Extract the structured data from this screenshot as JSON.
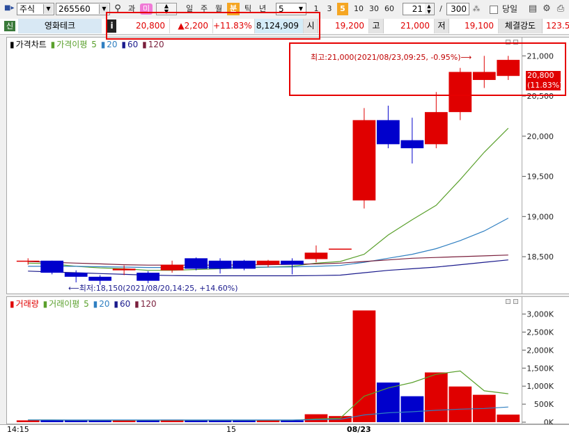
{
  "toolbar": {
    "market": "주식",
    "code": "265560",
    "search_glyph": "⚲",
    "btn_gwa": "과",
    "btn_mi": "미",
    "period_buttons": [
      "일",
      "주",
      "월",
      "분",
      "틱",
      "년"
    ],
    "selected_period": "분",
    "interval_value": "5",
    "interval_buttons": [
      "1",
      "3",
      "5",
      "10",
      "30",
      "60"
    ],
    "selected_interval": "5",
    "count_value": "21",
    "slash": "/",
    "total_value": "300",
    "same_day_label": "당일"
  },
  "quote": {
    "sin_label": "신",
    "name": "영화테크",
    "info_label": "i",
    "price": "20,800",
    "change": "▲2,200",
    "change_pct": "+11.83%",
    "volume": "8,124,909",
    "open_label": "시",
    "open": "19,200",
    "high_label": "고",
    "high": "21,000",
    "low_label": "저",
    "low": "19,100",
    "strength_label": "체결강도",
    "strength": "123.5"
  },
  "price_chart": {
    "legend_title": "가격차트",
    "legend_ma_label": "가격이평",
    "legend_ma": [
      "5",
      "20",
      "60",
      "120"
    ],
    "y_ticks": [
      "21,000",
      "20,500",
      "20,000",
      "19,500",
      "19,000",
      "18,500"
    ],
    "high_annotation": "최고:21,000(2021/08/23,09:25, -0.95%)⟶",
    "low_annotation": "⟵최저:18,150(2021/08/20,14:25, +14.60%)",
    "current_price_label": "20,800",
    "current_pct_label": "(11.83%)"
  },
  "volume_chart": {
    "legend_title": "거래량",
    "legend_ma_label": "거래이평",
    "legend_ma": [
      "5",
      "20",
      "60",
      "120"
    ],
    "y_ticks": [
      "3,000K",
      "2,500K",
      "2,000K",
      "1,500K",
      "1,000K",
      "500K",
      "0K"
    ]
  },
  "x_axis": {
    "labels": [
      "14:15",
      "15",
      "08/23"
    ]
  },
  "colors": {
    "up": "#e00000",
    "down": "#0000cc",
    "ma5": "#5aa02c",
    "ma20": "#2f7fc1",
    "ma60": "#1a1a8c",
    "ma120": "#7a1f3c",
    "highlight": "#e60000"
  },
  "chart_data": [
    {
      "type": "candlestick",
      "title": "가격차트",
      "x": [
        "c1",
        "c2",
        "c3",
        "c4",
        "c5",
        "c6",
        "c7",
        "c8",
        "c9",
        "c10",
        "c11",
        "c12",
        "c13",
        "c14",
        "c15",
        "c16",
        "c17",
        "c18",
        "c19",
        "c20",
        "c21"
      ],
      "open": [
        18450,
        18450,
        18300,
        18250,
        18330,
        18300,
        18330,
        18480,
        18450,
        18450,
        18400,
        18450,
        18470,
        18600,
        19200,
        20200,
        19950,
        19900,
        20300,
        20700,
        20750
      ],
      "close": [
        18450,
        18300,
        18250,
        18200,
        18350,
        18200,
        18400,
        18350,
        18350,
        18350,
        18450,
        18400,
        18550,
        18600,
        20200,
        19900,
        19850,
        20300,
        20800,
        20800,
        20950
      ],
      "high": [
        18480,
        18450,
        18330,
        18270,
        18390,
        18320,
        18450,
        18490,
        18480,
        18460,
        18460,
        18480,
        18640,
        18600,
        20350,
        20380,
        20230,
        20550,
        20850,
        21000,
        21000
      ],
      "low": [
        18400,
        18280,
        18180,
        18150,
        18270,
        18170,
        18300,
        18330,
        18290,
        18330,
        18370,
        18280,
        18430,
        18600,
        19100,
        19850,
        19660,
        19850,
        20200,
        20600,
        20700
      ],
      "ma_series": [
        {
          "name": "5",
          "values": [
            18420,
            18410,
            18380,
            18360,
            18350,
            18330,
            18330,
            18340,
            18350,
            18360,
            18370,
            18380,
            18420,
            18440,
            18530,
            18770,
            18960,
            19140,
            19460,
            19800,
            20100
          ]
        },
        {
          "name": "20",
          "values": [
            18380,
            18380,
            18380,
            18375,
            18370,
            18365,
            18365,
            18365,
            18368,
            18368,
            18370,
            18372,
            18380,
            18390,
            18430,
            18480,
            18530,
            18600,
            18700,
            18820,
            18980
          ]
        },
        {
          "name": "60",
          "values": [
            18320,
            18310,
            18300,
            18290,
            18280,
            18270,
            18265,
            18262,
            18262,
            18262,
            18262,
            18262,
            18265,
            18270,
            18300,
            18330,
            18350,
            18370,
            18400,
            18430,
            18460
          ]
        },
        {
          "name": "120",
          "values": [
            18440,
            18430,
            18420,
            18410,
            18400,
            18395,
            18395,
            18395,
            18395,
            18398,
            18400,
            18405,
            18410,
            18420,
            18440,
            18460,
            18480,
            18490,
            18500,
            18510,
            18520
          ]
        }
      ],
      "ylim": [
        18050,
        21150
      ]
    },
    {
      "type": "bar",
      "title": "거래량",
      "x": [
        "c1",
        "c2",
        "c3",
        "c4",
        "c5",
        "c6",
        "c7",
        "c8",
        "c9",
        "c10",
        "c11",
        "c12",
        "c13",
        "c14",
        "c15",
        "c16",
        "c17",
        "c18",
        "c19",
        "c20",
        "c21"
      ],
      "values": [
        50,
        60,
        50,
        60,
        50,
        60,
        70,
        50,
        50,
        50,
        60,
        50,
        220,
        170,
        3100,
        1100,
        720,
        1380,
        990,
        760,
        210
      ],
      "unit": "K",
      "ma_series": [
        {
          "name": "5",
          "values": [
            60,
            60,
            55,
            55,
            55,
            55,
            56,
            56,
            56,
            55,
            55,
            55,
            90,
            110,
            720,
            950,
            1100,
            1330,
            1420,
            870,
            790
          ]
        },
        {
          "name": "20",
          "values": [
            60,
            60,
            60,
            60,
            60,
            60,
            60,
            60,
            60,
            60,
            60,
            60,
            70,
            80,
            200,
            260,
            290,
            330,
            360,
            380,
            420
          ]
        }
      ],
      "ylim": [
        0,
        3300
      ]
    }
  ]
}
